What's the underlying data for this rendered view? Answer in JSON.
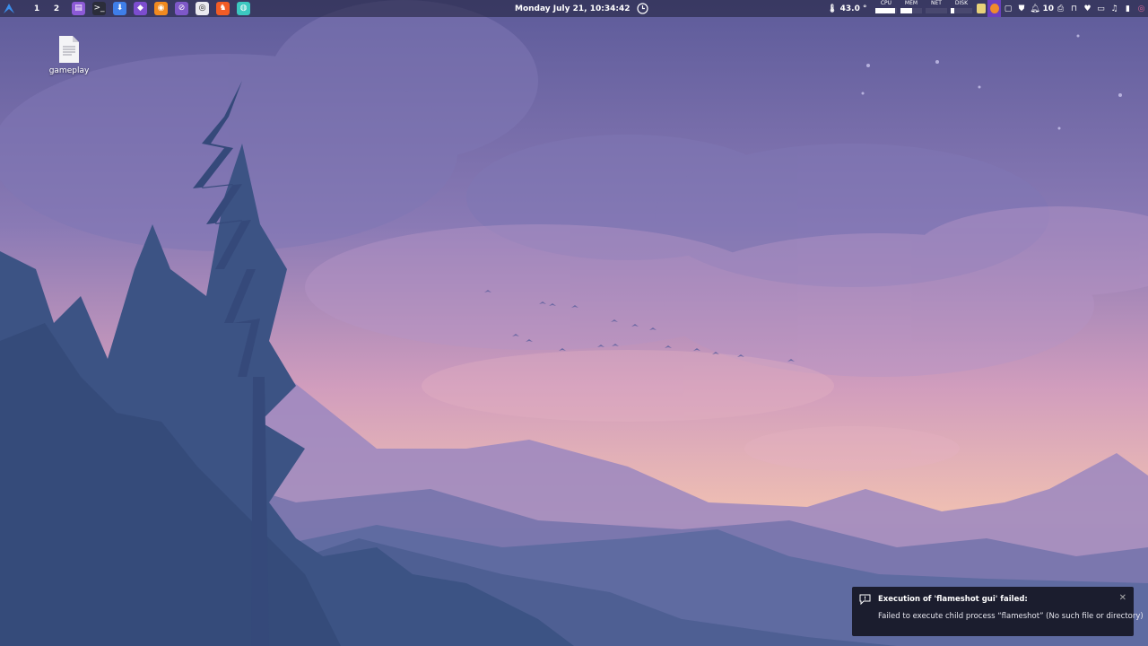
{
  "panel": {
    "workspaces": [
      "1",
      "2"
    ],
    "apps": [
      {
        "name": "file-manager-icon",
        "color": "#8c5ad6",
        "glyph": "▤"
      },
      {
        "name": "terminal-icon",
        "color": "#2b2d3a",
        "glyph": ">_"
      },
      {
        "name": "download-icon",
        "color": "#3f7ee8",
        "glyph": "⬇"
      },
      {
        "name": "obsidian-icon",
        "color": "#7c4dcf",
        "glyph": "◆"
      },
      {
        "name": "blender-icon",
        "color": "#f18a1f",
        "glyph": "◉"
      },
      {
        "name": "blocked-app-icon",
        "color": "#7e58c8",
        "glyph": "⊘"
      },
      {
        "name": "obs-icon",
        "color": "#e9e9ef",
        "glyph": "◎"
      },
      {
        "name": "brave-icon",
        "color": "#f25c25",
        "glyph": "♞"
      },
      {
        "name": "planet-app-icon",
        "color": "#3cc8c0",
        "glyph": "◍"
      }
    ],
    "clock": "Monday July 21, 10:34:42",
    "temperature": "43.0 °",
    "meters": [
      {
        "label": "CPU",
        "level": 0.9
      },
      {
        "label": "MEM",
        "level": 0.55
      },
      {
        "label": "NET",
        "level": 0.0
      },
      {
        "label": "DISK",
        "level": 0.15
      }
    ],
    "notification_count": "10"
  },
  "desktop": {
    "file_label": "gameplay"
  },
  "notification": {
    "title": "Execution of 'flameshot gui' failed:",
    "body": "Failed to execute child process “flameshot” (No such file or directory)",
    "close_glyph": "✕"
  },
  "colors": {
    "panel_bg": "#1c1e34",
    "accent_blue": "#3b8eea",
    "notification_bg": "#161826"
  }
}
